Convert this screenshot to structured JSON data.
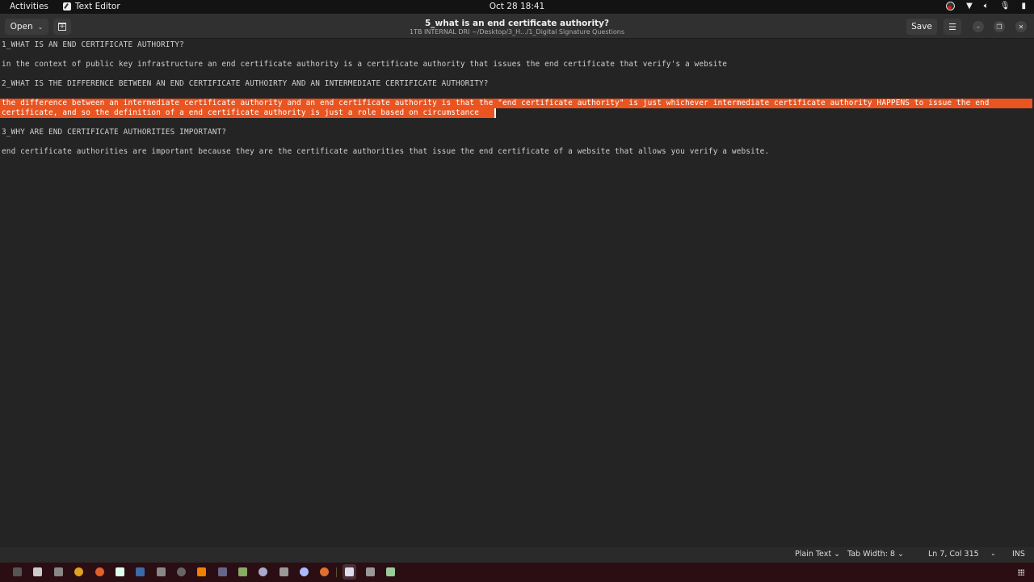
{
  "topbar": {
    "activities": "Activities",
    "app_name": "Text Editor",
    "clock": "Oct 28  18:41",
    "tray_icons": [
      "ubuntu-icon",
      "wifi-icon",
      "volume-icon",
      "microphone-icon",
      "battery-icon"
    ]
  },
  "header": {
    "open_label": "Open",
    "title": "5_what is an end certificate authority?",
    "subtitle": "1TB INTERNAL DRI ~/Desktop/3_H.../1_Digital Signature Questions",
    "save_label": "Save",
    "menu_icon": "☰",
    "minimize_icon": "–",
    "maximize_icon": "❐",
    "close_icon": "✕"
  },
  "document": {
    "lines": [
      "1_WHAT IS AN END CERTIFICATE AUTHORITY?",
      "in the context of public key infrastructure an end certificate authority is a certificate authority that issues the end certificate that verify's a website",
      "2_WHAT IS THE DIFFERENCE BETWEEN AN END CERTIFICATE AUTHOIRTY AND AN INTERMEDIATE CERTIFICATE AUTHORITY?",
      "the difference between an intermediate certificate authority and an end certificate authority is that the \"end certificate authority\" is just whichever intermediate certificate authority HAPPENS to issue the end",
      "certificate, and so the definition of a end certificate authority is just a role based on circumstance",
      "3_WHY ARE END CERTIFICATE AUTHORITIES IMPORTANT?",
      "end certificate authorities are important because they are the certificate authorities that issue the end certificate of a website that allows you verify a website."
    ],
    "selection_color": "#e95420"
  },
  "statusbar": {
    "language": "Plain Text",
    "tab_width": "Tab Width: 8",
    "position": "Ln 7, Col 315",
    "mode": "INS"
  },
  "dock": {
    "apps": [
      {
        "name": "terminal-icon",
        "color": "#555"
      },
      {
        "name": "disks-icon",
        "color": "#ccc"
      },
      {
        "name": "files-icon",
        "color": "#888"
      },
      {
        "name": "chrome-icon",
        "color": "#e0a020"
      },
      {
        "name": "firefox-icon",
        "color": "#e0602a"
      },
      {
        "name": "app-icon",
        "color": "#dfe"
      },
      {
        "name": "steam-icon",
        "color": "#3a6aa8"
      },
      {
        "name": "gamepad-icon",
        "color": "#888"
      },
      {
        "name": "obs-icon",
        "color": "#666"
      },
      {
        "name": "vlc-icon",
        "color": "#f08000"
      },
      {
        "name": "app2-icon",
        "color": "#668"
      },
      {
        "name": "minecraft-icon",
        "color": "#8a6"
      },
      {
        "name": "keepass-icon",
        "color": "#aac"
      },
      {
        "name": "tool-icon",
        "color": "#999"
      },
      {
        "name": "signal-icon",
        "color": "#aabbff"
      },
      {
        "name": "app3-icon",
        "color": "#e07030"
      },
      {
        "name": "text-editor-icon",
        "color": "#dde"
      },
      {
        "name": "viewer-icon",
        "color": "#999"
      },
      {
        "name": "spreadsheet-icon",
        "color": "#9c9"
      }
    ]
  }
}
